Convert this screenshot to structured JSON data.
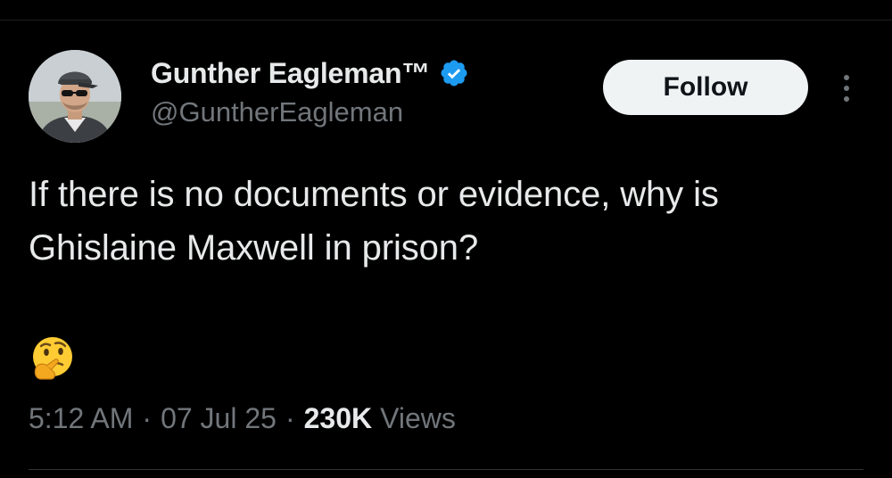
{
  "author": {
    "display_name": "Gunther Eagleman™",
    "handle": "@GuntherEagleman",
    "verified": true
  },
  "actions": {
    "follow_label": "Follow"
  },
  "tweet": {
    "text": "If there is no documents or evidence, why is Ghislaine Maxwell in prison?",
    "emoji": "🤔"
  },
  "meta": {
    "time": "5:12 AM",
    "separator": "·",
    "date": "07 Jul 25",
    "views_count": "230K",
    "views_label": "Views"
  },
  "icons": {
    "verified": "verified-badge-icon",
    "more": "more-options-icon",
    "emoji": "thinking-face-icon"
  },
  "colors": {
    "background": "#000000",
    "primary_text": "#e7e9ea",
    "secondary_text": "#71767b",
    "verified_blue": "#1d9bf0",
    "follow_button_bg": "#eff3f4"
  }
}
